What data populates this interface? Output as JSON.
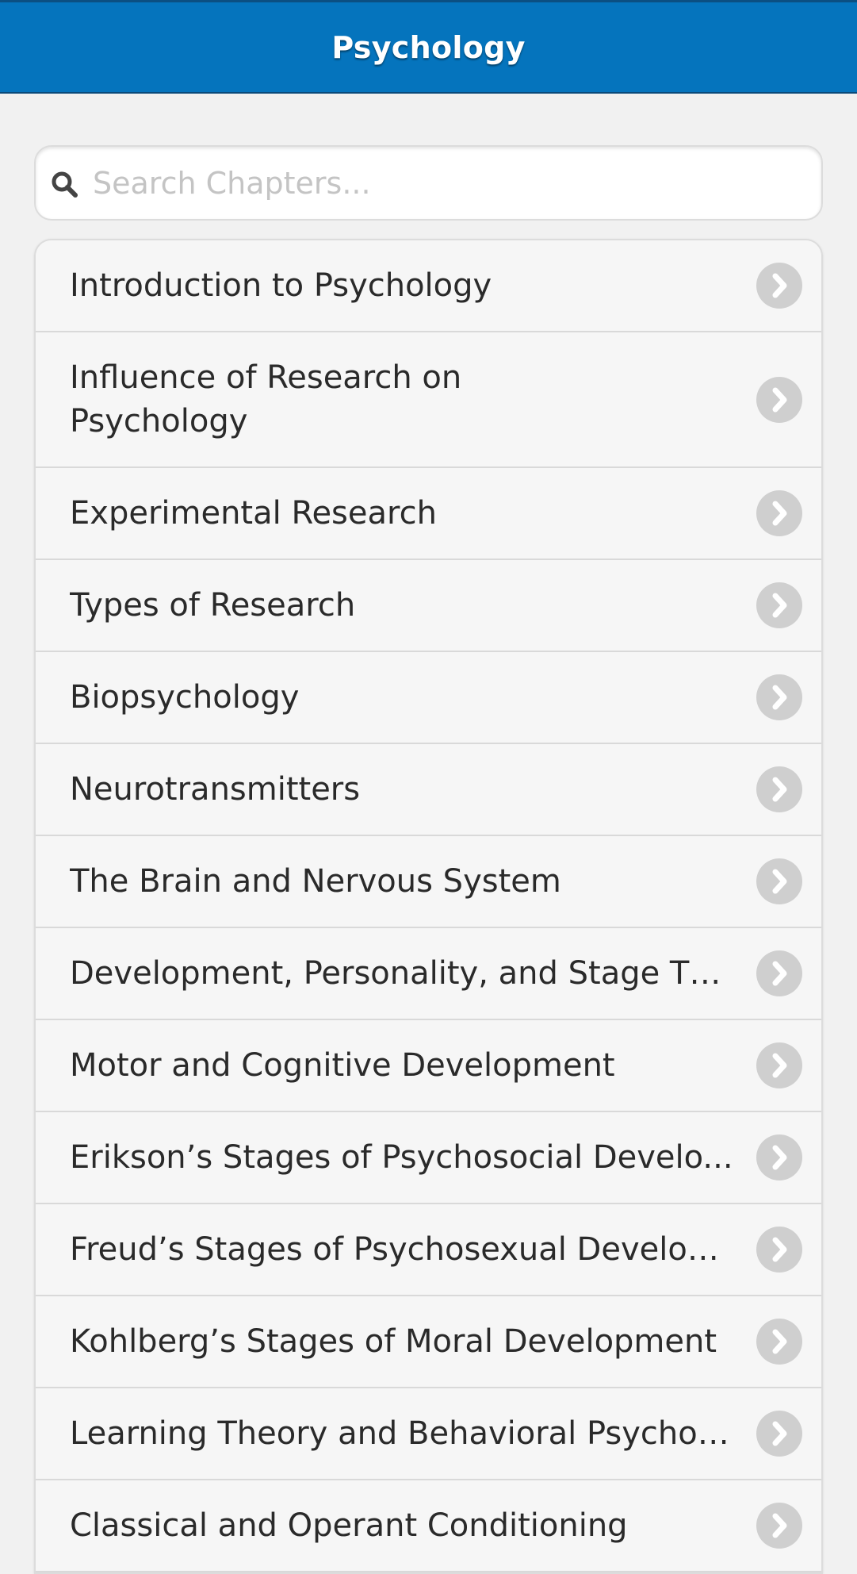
{
  "header": {
    "title": "Psychology"
  },
  "search": {
    "placeholder": "Search Chapters...",
    "value": "",
    "icon": "search-icon"
  },
  "chapters": [
    "Introduction to Psychology",
    "Influence of Research on Psychology",
    "Experimental Research",
    "Types of Research",
    "Biopsychology",
    "Neurotransmitters",
    "The Brain and Nervous System",
    "Development, Personality, and Stage Th...",
    "Motor and Cognitive Development",
    "Erikson’s Stages of Psychosocial Develo...",
    "Freud’s Stages of Psychosexual Develop...",
    "Kohlberg’s Stages of Moral Development",
    "Learning Theory and Behavioral Psychol...",
    "Classical and Operant Conditioning"
  ],
  "colors": {
    "header_bg": "#0574bd",
    "page_bg": "#f1f1f1",
    "list_bg": "#f6f6f6",
    "chevron_bg": "#cfcfcf"
  }
}
